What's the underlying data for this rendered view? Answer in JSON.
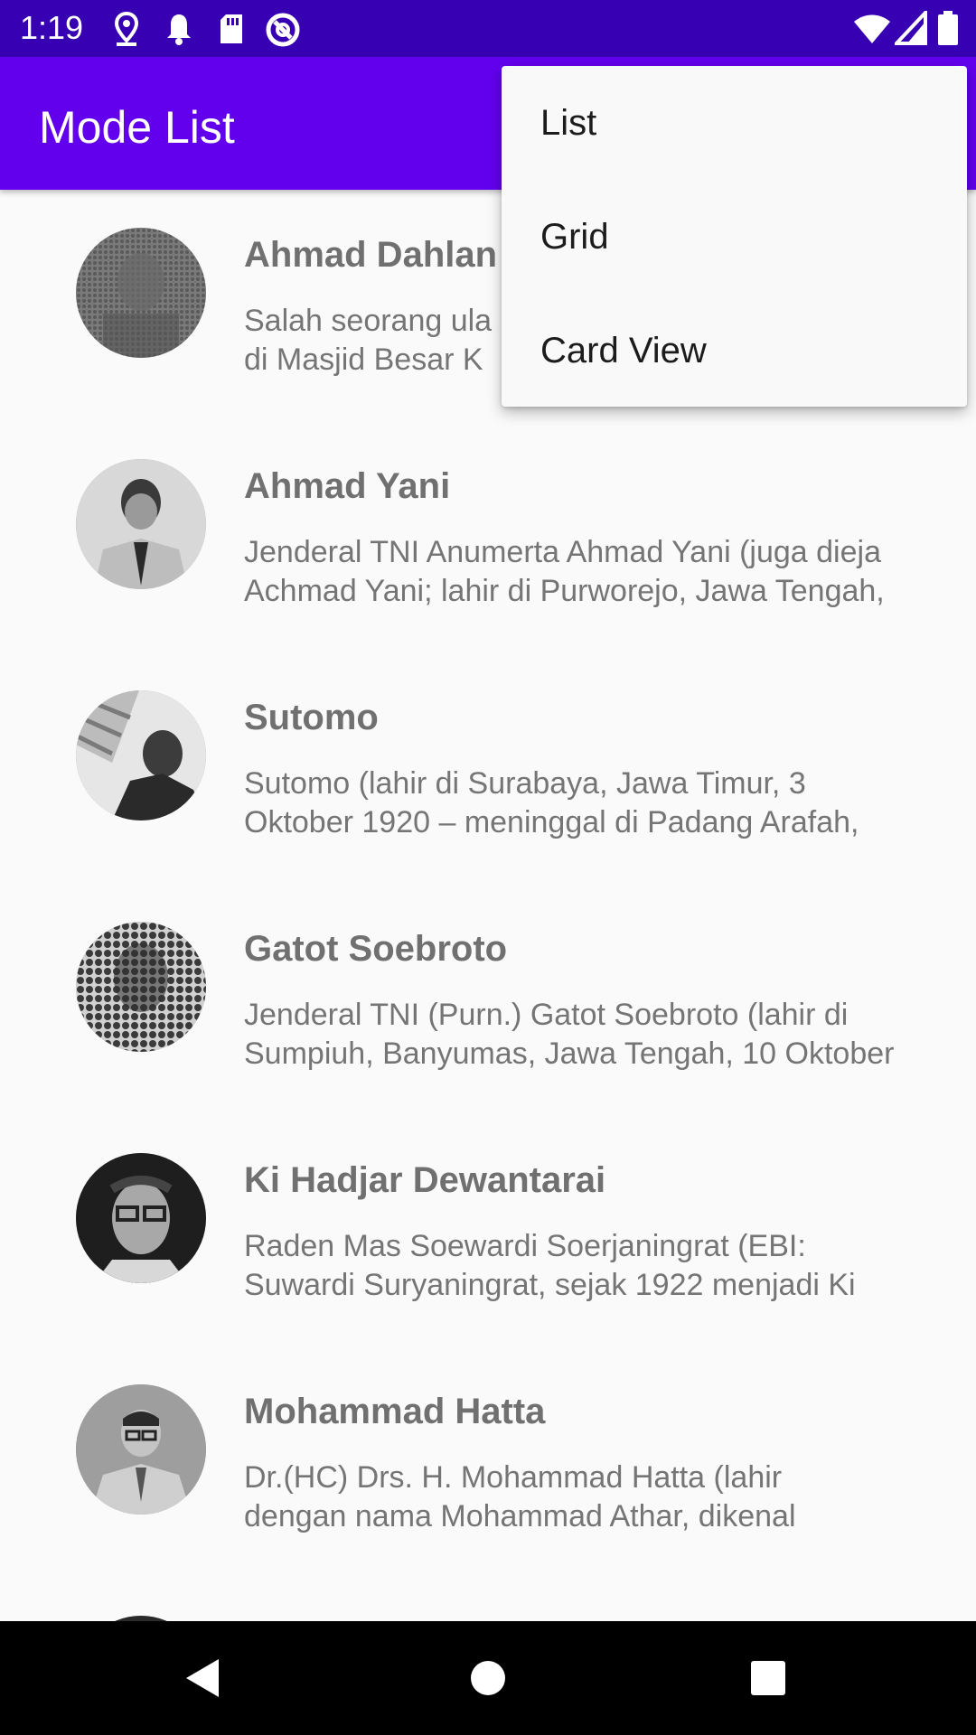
{
  "status_bar": {
    "time": "1:19",
    "left_icons": [
      "location-icon",
      "bell-icon",
      "sd-card-icon",
      "vpn-icon"
    ],
    "right_icons": [
      "wifi-icon",
      "signal-icon",
      "battery-icon"
    ]
  },
  "app_bar": {
    "title": "Mode List",
    "background": "#6200ee"
  },
  "popup_menu": {
    "items": [
      {
        "label": "List"
      },
      {
        "label": "Grid"
      },
      {
        "label": "Card View"
      }
    ]
  },
  "heroes": [
    {
      "name": "Ahmad Dahlan",
      "description": "Salah seorang ulama... di Masjid Besar K...",
      "visible_name": "Ahmad Dahlan",
      "desc_line1": "Salah seorang ula",
      "desc_line2": "di Masjid Besar K"
    },
    {
      "name": "Ahmad Yani",
      "desc_line1": "Jenderal TNI Anumerta Ahmad Yani (juga dieja",
      "desc_line2": "Achmad Yani; lahir di Purworejo, Jawa Tengah,"
    },
    {
      "name": "Sutomo",
      "desc_line1": "Sutomo (lahir di Surabaya, Jawa Timur, 3",
      "desc_line2": "Oktober 1920 – meninggal di Padang Arafah,"
    },
    {
      "name": "Gatot Soebroto",
      "desc_line1": "Jenderal TNI (Purn.) Gatot Soebroto (lahir di",
      "desc_line2": "Sumpiuh, Banyumas, Jawa Tengah, 10 Oktober"
    },
    {
      "name": "Ki Hadjar Dewantarai",
      "desc_line1": "Raden Mas Soewardi Soerjaningrat (EBI:",
      "desc_line2": "Suwardi Suryaningrat, sejak 1922 menjadi Ki"
    },
    {
      "name": "Mohammad Hatta",
      "desc_line1": "Dr.(HC) Drs. H. Mohammad Hatta (lahir",
      "desc_line2": "dengan nama Mohammad Athar, dikenal"
    }
  ],
  "nav_bar": {
    "buttons": [
      "back-icon",
      "home-icon",
      "recents-icon"
    ]
  },
  "colors": {
    "status_bar": "#3700b3",
    "app_bar": "#6200ee",
    "text_primary": "#707070",
    "text_secondary": "#757575"
  }
}
